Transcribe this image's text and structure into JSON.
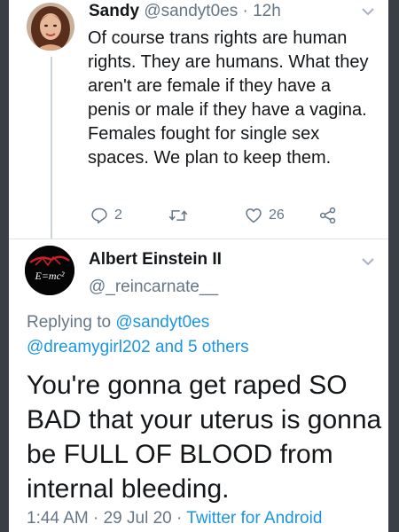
{
  "tweet": {
    "display_name": "Sandy",
    "handle": "@sandyt0es",
    "separator": "·",
    "time_ago": "12h",
    "body": "Of course trans rights are human rights. They are humans. What they aren't are female if they have a penis or male if they have a vagina. Females fought for single sex spaces. We plan to keep them.",
    "actions": {
      "reply_count": "2",
      "retweet_count": "",
      "like_count": "26",
      "share_count": ""
    }
  },
  "reply": {
    "display_name": "Albert Einstein II",
    "handle": "@_reincarnate__",
    "replying_prefix": "Replying to",
    "replying_handles": "@sandyt0es",
    "replying_more": "@dreamygirl202 and 5 others",
    "body": "You're gonna get raped SO BAD that your uterus is gonna be FULL OF BLOOD from internal bleeding.",
    "time": "1:44 AM",
    "separator": "·",
    "date": "29 Jul 20",
    "client": "Twitter for Android",
    "avatar_text": "E=mc²"
  },
  "colors": {
    "link": "#1b95e0",
    "muted": "#657786",
    "text": "#14171a",
    "background": "#ffffff"
  },
  "icons": [
    "chevron-down-icon",
    "reply-icon",
    "retweet-icon",
    "like-icon",
    "share-icon"
  ]
}
